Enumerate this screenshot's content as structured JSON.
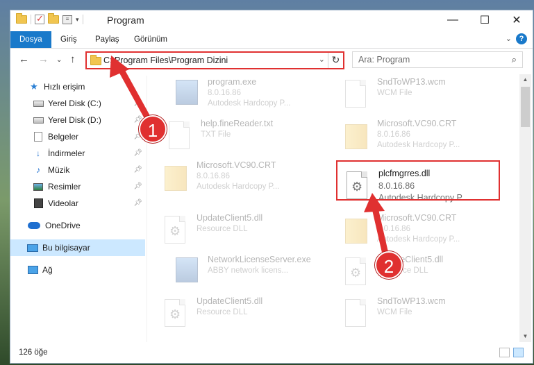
{
  "window": {
    "title": "Program",
    "controls": {
      "minimize": "—",
      "maximize": "☐",
      "close": "✕"
    }
  },
  "ribbon": {
    "tabs": [
      "Dosya",
      "Giriş",
      "Paylaş",
      "Görünüm"
    ],
    "help": "?"
  },
  "address": {
    "path": "C:\\Program Files\\Program Dizini",
    "search_placeholder": "Ara: Program"
  },
  "sidebar": {
    "items": [
      {
        "label": "Hızlı erişim",
        "icon": "star-icon"
      },
      {
        "label": "Yerel Disk (C:)",
        "icon": "drive-icon"
      },
      {
        "label": "Yerel Disk (D:)",
        "icon": "drive-icon"
      },
      {
        "label": "Belgeler",
        "icon": "documents-icon"
      },
      {
        "label": "İndirmeler",
        "icon": "downloads-icon"
      },
      {
        "label": "Müzik",
        "icon": "music-icon"
      },
      {
        "label": "Resimler",
        "icon": "pictures-icon"
      },
      {
        "label": "Videolar",
        "icon": "videos-icon"
      },
      {
        "label": "OneDrive",
        "icon": "onedrive-icon"
      },
      {
        "label": "Bu bilgisayar",
        "icon": "this-pc-icon"
      },
      {
        "label": "Ağ",
        "icon": "network-icon"
      }
    ]
  },
  "files": [
    {
      "name": "program.exe",
      "line1": "8.0.16.86",
      "line2": "Autodesk Hardcopy P...",
      "icon": "exe-icon"
    },
    {
      "name": "SndToWP13.wcm",
      "line1": "WCM File",
      "line2": "",
      "icon": "file-icon"
    },
    {
      "name": "help.fineReader.txt",
      "line1": "TXT File",
      "line2": "",
      "icon": "text-file-icon"
    },
    {
      "name": "Microsoft.VC90.CRT",
      "line1": "8.0.16.86",
      "line2": "Autodesk Hardcopy P...",
      "icon": "folder-icon"
    },
    {
      "name": "Microsoft.VC90.CRT",
      "line1": "8.0.16.86",
      "line2": "Autodesk Hardcopy P...",
      "icon": "folder-icon"
    },
    {
      "name": "plcfmgrres.dll",
      "line1": "8.0.16.86",
      "line2": "Autodesk Hardcopy P...",
      "icon": "dll-icon"
    },
    {
      "name": "UpdateClient5.dll",
      "line1": "Resource DLL",
      "line2": "",
      "icon": "dll-icon"
    },
    {
      "name": "Microsoft.VC90.CRT",
      "line1": "8.0.16.86",
      "line2": "Autodesk Hardcopy P...",
      "icon": "folder-icon"
    },
    {
      "name": "NetworkLicenseServer.exe",
      "line1": "ABBY network licens...",
      "line2": "",
      "icon": "exe-icon"
    },
    {
      "name": "UpdateClient5.dll",
      "line1": "Resource DLL",
      "line2": "",
      "icon": "dll-icon"
    },
    {
      "name": "UpdateClient5.dll",
      "line1": "Resource DLL",
      "line2": "",
      "icon": "dll-icon"
    },
    {
      "name": "SndToWP13.wcm",
      "line1": "WCM File",
      "line2": "",
      "icon": "file-icon"
    }
  ],
  "status": {
    "count": "126 öğe"
  },
  "callouts": [
    "1",
    "2"
  ],
  "colors": {
    "accent": "#1979ca",
    "highlight": "#e03030",
    "selected": "#cce8ff"
  }
}
